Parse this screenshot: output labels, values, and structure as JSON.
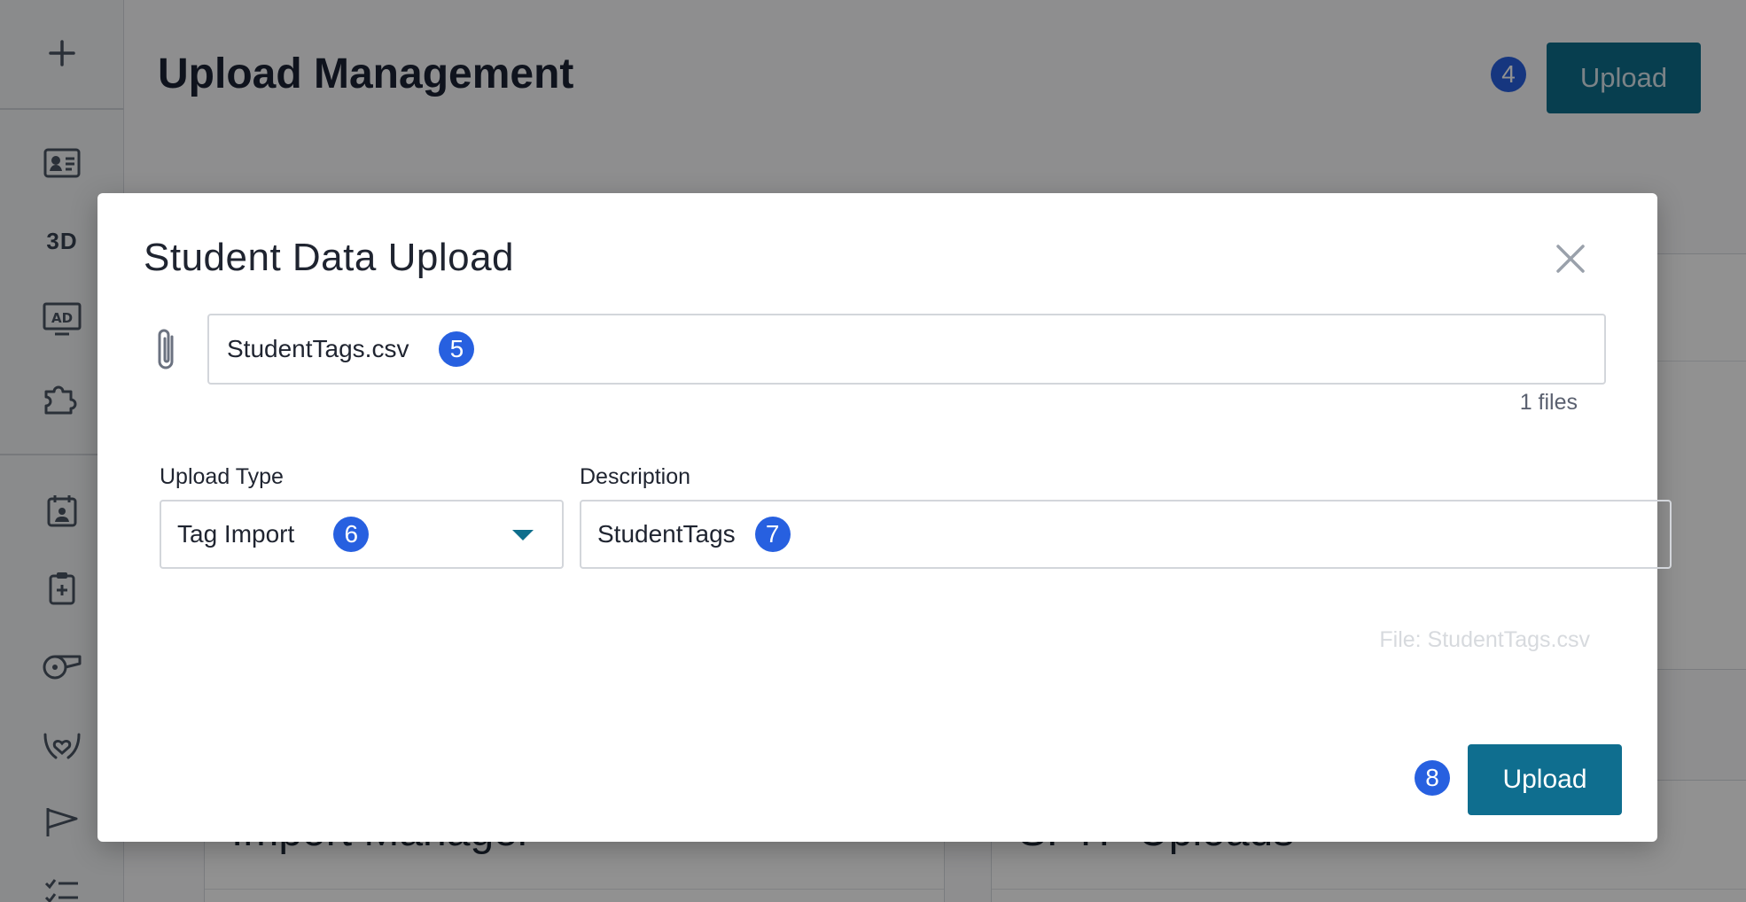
{
  "app": {
    "page_title": "Upload Management",
    "top_upload_label": "Upload",
    "top_upload_step": "4"
  },
  "sidebar": {
    "items": [
      {
        "icon": "plus-icon"
      },
      {
        "icon": "id-card-icon"
      },
      {
        "label": "3D"
      },
      {
        "icon": "ad-display-icon"
      },
      {
        "icon": "puzzle-icon"
      },
      {
        "icon": "calendar-person-icon"
      },
      {
        "icon": "clipboard-medical-icon"
      },
      {
        "icon": "whistle-icon"
      },
      {
        "icon": "hands-heart-icon"
      },
      {
        "icon": "flag-icon"
      },
      {
        "icon": "checklist-icon"
      }
    ]
  },
  "cards": {
    "left_title": "Import Manager",
    "right_title": "SFTP Uploads"
  },
  "modal": {
    "title": "Student Data Upload",
    "file_name": "StudentTags.csv",
    "file_step": "5",
    "file_count": "1 files",
    "upload_type_label": "Upload Type",
    "upload_type_value": "Tag Import",
    "upload_type_step": "6",
    "description_label": "Description",
    "description_value": "StudentTags",
    "description_step": "7",
    "file_note": "File: StudentTags.csv",
    "upload_label": "Upload",
    "upload_step": "8"
  },
  "colors": {
    "accent": "#0e6e8c",
    "step_badge": "#2760e0"
  }
}
